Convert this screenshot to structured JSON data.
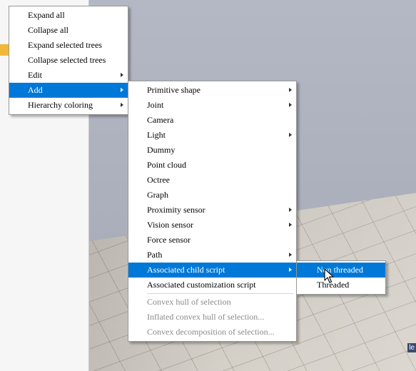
{
  "scene": {
    "corner_label": "le"
  },
  "colors": {
    "highlight": "#0078d7",
    "disabled_text": "#8a8a8a"
  },
  "context_menu": {
    "items": [
      {
        "label": "Expand all",
        "submenu": false
      },
      {
        "label": "Collapse all",
        "submenu": false
      },
      {
        "label": "Expand selected trees",
        "submenu": false
      },
      {
        "label": "Collapse selected trees",
        "submenu": false
      },
      {
        "label": "Edit",
        "submenu": true
      },
      {
        "label": "Add",
        "submenu": true,
        "highlighted": true
      },
      {
        "label": "Hierarchy coloring",
        "submenu": true
      }
    ]
  },
  "add_menu": {
    "items": [
      {
        "label": "Primitive shape",
        "submenu": true
      },
      {
        "label": "Joint",
        "submenu": true
      },
      {
        "label": "Camera",
        "submenu": false
      },
      {
        "label": "Light",
        "submenu": true
      },
      {
        "label": "Dummy",
        "submenu": false
      },
      {
        "label": "Point cloud",
        "submenu": false
      },
      {
        "label": "Octree",
        "submenu": false
      },
      {
        "label": "Graph",
        "submenu": false
      },
      {
        "label": "Proximity sensor",
        "submenu": true
      },
      {
        "label": "Vision sensor",
        "submenu": true
      },
      {
        "label": "Force sensor",
        "submenu": false
      },
      {
        "label": "Path",
        "submenu": true
      },
      {
        "label": "Associated child script",
        "submenu": true,
        "highlighted": true
      },
      {
        "label": "Associated customization script",
        "submenu": false
      }
    ],
    "disabled_items": [
      {
        "label": "Convex hull of selection"
      },
      {
        "label": "Inflated convex hull of selection..."
      },
      {
        "label": "Convex decomposition of selection..."
      }
    ]
  },
  "child_script_menu": {
    "items": [
      {
        "label": "Non threaded",
        "highlighted": true
      },
      {
        "label": "Threaded"
      }
    ]
  }
}
